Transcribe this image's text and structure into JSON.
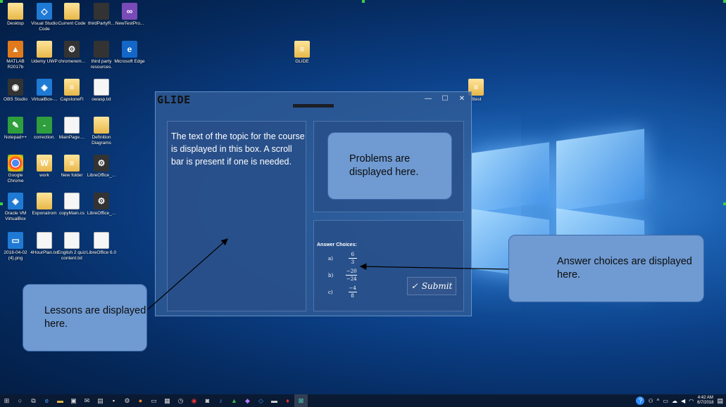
{
  "desktop": {
    "icons": [
      {
        "label": "Desktop",
        "icon": "folder-icon"
      },
      {
        "label": "Visual Studio Code",
        "icon": "vscode-icon"
      },
      {
        "label": "Current Code",
        "icon": "folder-icon"
      },
      {
        "label": "thirdPartyR...",
        "icon": "screenshot-icon"
      },
      {
        "label": "NewTestPro...",
        "icon": "vs-project-icon"
      },
      {
        "label": "MATLAB R2017b",
        "icon": "matlab-icon"
      },
      {
        "label": "Udemy UWP",
        "icon": "folder-icon"
      },
      {
        "label": "chromerem...",
        "icon": "installer-icon"
      },
      {
        "label": "third party resources.",
        "icon": "screenshot-icon"
      },
      {
        "label": "Microsoft Edge",
        "icon": "edge-icon"
      },
      {
        "label": "GLIDE",
        "icon": "zip-folder-icon"
      },
      {
        "label": "OBS Studio",
        "icon": "obs-icon"
      },
      {
        "label": "VirtualBox-...",
        "icon": "virtualbox-icon"
      },
      {
        "label": "CapstoneFi",
        "icon": "zip-folder-icon"
      },
      {
        "label": "owasp.txt",
        "icon": "text-file-icon"
      },
      {
        "label": "Btest",
        "icon": "zip-folder-icon"
      },
      {
        "label": "Notepad++",
        "icon": "notepadpp-icon"
      },
      {
        "label": "correction.",
        "icon": "green-file-icon"
      },
      {
        "label": "MainPage....",
        "icon": "csharp-file-icon"
      },
      {
        "label": "Definition Diagrams",
        "icon": "folder-icon"
      },
      {
        "label": "Google Chrome",
        "icon": "chrome-icon"
      },
      {
        "label": "work",
        "icon": "word-doc-icon"
      },
      {
        "label": "New folder",
        "icon": "zip-folder-icon"
      },
      {
        "label": "LibreOffice_...",
        "icon": "installer-icon"
      },
      {
        "label": "Oracle VM VirtualBox",
        "icon": "virtualbox-icon"
      },
      {
        "label": "Exponatrom",
        "icon": "folder-icon"
      },
      {
        "label": "copyMain.cs",
        "icon": "csharp-file-icon"
      },
      {
        "label": "LibreOffice_...",
        "icon": "installer-icon"
      },
      {
        "label": "2018-04-02 (4).png",
        "icon": "image-file-icon"
      },
      {
        "label": "4HourPlan.txt",
        "icon": "text-file-icon"
      },
      {
        "label": "English 2 quiz content.txt",
        "icon": "text-file-icon"
      },
      {
        "label": "LibreOffice 6.0",
        "icon": "libreoffice-icon"
      }
    ]
  },
  "app": {
    "title": "GLIDE",
    "controls": {
      "minimize": "—",
      "maximize": "☐",
      "close": "✕"
    },
    "lesson_text": "The text of the topic for the course is displayed in this box. A scroll bar is present if one is needed.",
    "answers": {
      "title": "Answer Choices:",
      "choices": [
        {
          "letter": "a)",
          "numerator": "6",
          "denominator": "3"
        },
        {
          "letter": "b)",
          "numerator": "−20",
          "denominator": "−24"
        },
        {
          "letter": "c)",
          "numerator": "−4",
          "denominator": "8"
        }
      ],
      "submit_label": "Submit"
    }
  },
  "callouts": {
    "problems": "Problems are displayed here.",
    "answers": "Answer choices are displayed here.",
    "lessons": "Lessons are displayed here."
  },
  "taskbar": {
    "clock_time": "4:42 AM",
    "clock_date": "6/7/2018"
  },
  "colors": {
    "callout_fill": "#6f9ad2",
    "app_background": "#305c96",
    "taskbar": "#0b1a33"
  }
}
